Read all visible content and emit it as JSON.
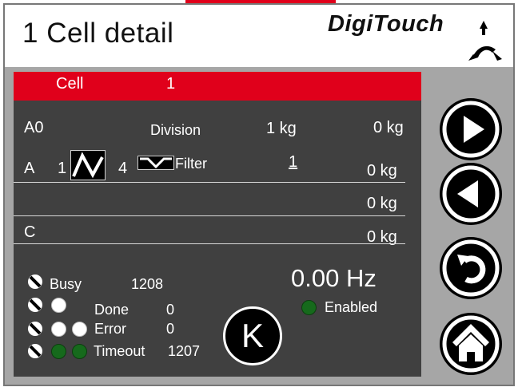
{
  "header": {
    "title": "1  Cell detail",
    "logo_text": "DigiTouch"
  },
  "cell_bar": {
    "label": "Cell",
    "value": "1"
  },
  "rows": {
    "a0": {
      "name": "A0",
      "division_label": "Division",
      "division_value": "1 kg",
      "weight": "0 kg"
    },
    "a": {
      "name": "A",
      "num_left": "1",
      "num_right": "4",
      "filter_label": "Filter",
      "filter_value": "1",
      "weight": "0 kg"
    },
    "row3": {
      "weight": "0 kg"
    },
    "c": {
      "name": "C",
      "weight": "0 kg"
    }
  },
  "status": {
    "busy_label": "Busy",
    "busy_value": "1208",
    "done_label": "Done",
    "done_value": "0",
    "error_label": "Error",
    "error_value": "0",
    "timeout_label": "Timeout",
    "timeout_value": "1207"
  },
  "frequency": "0.00 Hz",
  "enabled_label": "Enabled",
  "k_button_label": "K",
  "colors": {
    "accent_red": "#e0001b",
    "panel_dark": "#404040",
    "side_gray": "#a6a6a6",
    "indicator_green": "#166a1c"
  },
  "side_buttons": [
    "play-icon",
    "back-icon",
    "undo-icon",
    "home-icon"
  ]
}
